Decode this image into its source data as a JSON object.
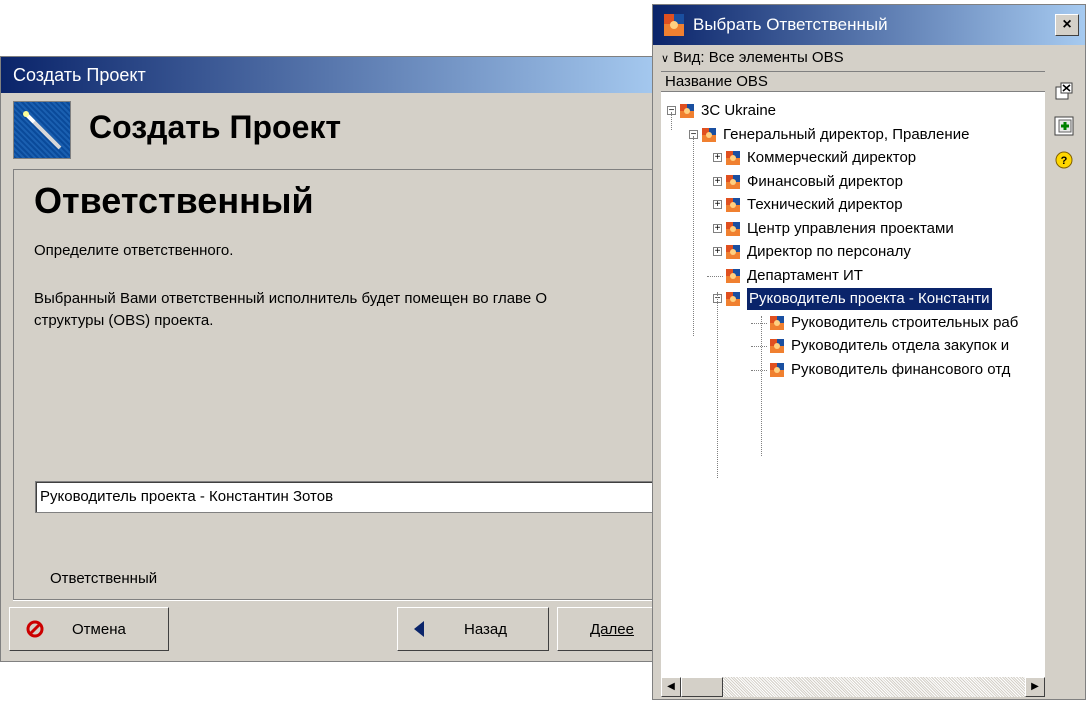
{
  "wizard": {
    "title": "Создать Проект",
    "heading": "Создать Проект",
    "panel_title": "Ответственный",
    "desc1": "Определите ответственного.",
    "desc2": "Выбранный Вами ответственный исполнитель будет помещен во главе О\nструктуры (OBS) проекта.",
    "field_label": "Ответственный",
    "field_value": "Руководитель проекта  - Константин Зотов",
    "buttons": {
      "cancel": "Отмена",
      "back": "Назад",
      "next": "Далее"
    }
  },
  "obs_window": {
    "title": "Выбрать Ответственный",
    "close": "×",
    "view_label": "Вид: Все элементы OBS",
    "column_header": "Название OBS",
    "tree": [
      {
        "label": "3C Ukraine",
        "level": 0,
        "expander": "minus"
      },
      {
        "label": "Генеральный директор, Правление",
        "level": 1,
        "expander": "minus"
      },
      {
        "label": "Коммерческий директор",
        "level": 2,
        "expander": "plus"
      },
      {
        "label": "Финансовый директор",
        "level": 2,
        "expander": "plus"
      },
      {
        "label": "Технический директор",
        "level": 2,
        "expander": "plus"
      },
      {
        "label": "Центр управления проектами",
        "level": 2,
        "expander": "plus"
      },
      {
        "label": "Директор по персоналу",
        "level": 2,
        "expander": "plus"
      },
      {
        "label": "Департамент ИТ",
        "level": 2,
        "expander": "none"
      },
      {
        "label": "Руководитель проекта  - Константи",
        "level": 2,
        "expander": "minus",
        "selected": true
      },
      {
        "label": "Руководитель строительных раб",
        "level": 3,
        "expander": "none"
      },
      {
        "label": "Руководитель отдела закупок и",
        "level": 3,
        "expander": "none"
      },
      {
        "label": "Руководитель финансового отд",
        "level": 3,
        "expander": "none"
      }
    ]
  },
  "colors": {
    "title_bar_start": "#0a246a",
    "title_bar_end": "#a6caf0",
    "window_bg": "#d4d0c8",
    "selection": "#0a246a"
  }
}
